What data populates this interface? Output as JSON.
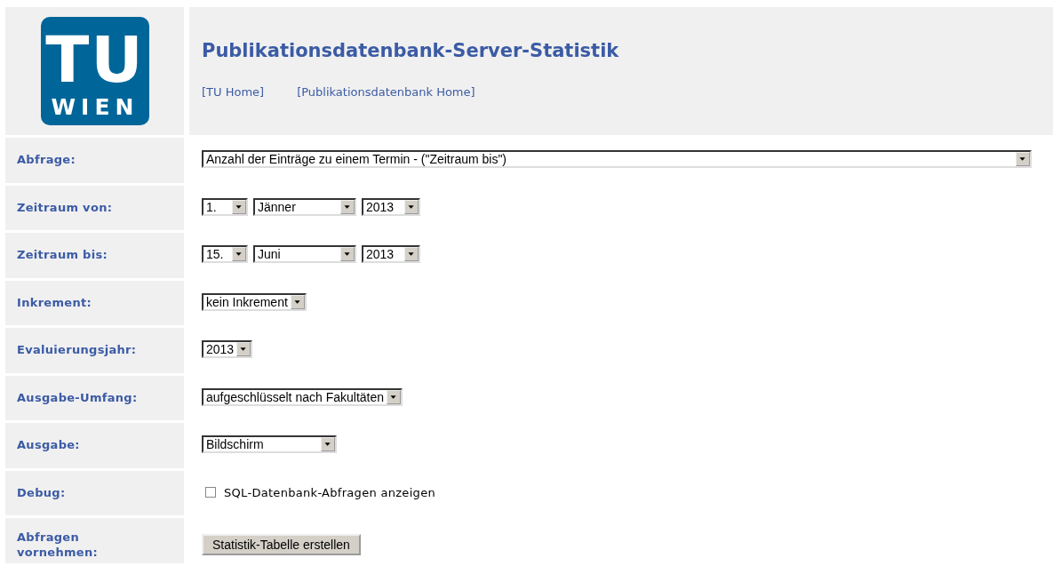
{
  "header": {
    "logo": {
      "top": "TU",
      "bottom": "WIEN"
    },
    "title": "Publikationsdatenbank-Server-Statistik",
    "links": [
      "[TU Home]",
      "[Publikationsdatenbank Home]"
    ]
  },
  "rows": [
    {
      "kind": "select",
      "label": "Abfrage:",
      "selects": [
        {
          "kind": "full",
          "value": "Anzahl der Einträge zu einem Termin - (\"Zeitraum bis\")"
        }
      ]
    },
    {
      "kind": "select",
      "label": "Zeitraum von:",
      "selects": [
        {
          "kind": "day",
          "value": "1."
        },
        {
          "kind": "month",
          "value": "Jänner"
        },
        {
          "kind": "year",
          "value": "2013"
        }
      ]
    },
    {
      "kind": "select",
      "label": "Zeitraum bis:",
      "selects": [
        {
          "kind": "day",
          "value": "15."
        },
        {
          "kind": "month",
          "value": "Juni"
        },
        {
          "kind": "year",
          "value": "2013"
        }
      ]
    },
    {
      "kind": "select",
      "label": "Inkrement:",
      "selects": [
        {
          "kind": "fit",
          "value": "kein Inkrement"
        }
      ]
    },
    {
      "kind": "select",
      "label": "Evaluierungsjahr:",
      "selects": [
        {
          "kind": "fit",
          "value": "2013"
        }
      ]
    },
    {
      "kind": "select",
      "label": "Ausgabe-Umfang:",
      "selects": [
        {
          "kind": "fit",
          "value": "aufgeschlüsselt nach Fakultäten"
        }
      ]
    },
    {
      "kind": "select",
      "label": "Ausgabe:",
      "selects": [
        {
          "kind": "medium",
          "value": "Bildschirm"
        }
      ]
    },
    {
      "kind": "checkbox",
      "label": "Debug:",
      "text": "SQL-Datenbank-Abfragen anzeigen",
      "checked": false
    },
    {
      "kind": "button",
      "label": "Abfragen vornehmen:",
      "text": "Statistik-Tabelle erstellen"
    }
  ]
}
